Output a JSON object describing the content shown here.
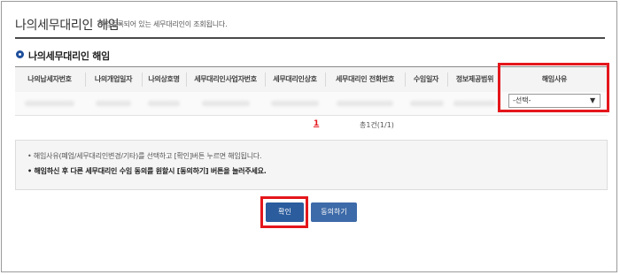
{
  "header": {
    "title": "나의세무대리인 해임",
    "description": "수임등록되어 있는 세무대리인이 조회됩니다."
  },
  "section": {
    "title": "나의세무대리인 해임"
  },
  "table": {
    "columns": [
      "나의납세자번호",
      "나의개업일자",
      "나의상호명",
      "세무대리인사업자번호",
      "세무대리인상호",
      "세무대리인 전화번호",
      "수임일자",
      "정보제공범위",
      "해임사유"
    ],
    "reason_select": {
      "selected": "-선택-"
    }
  },
  "pagination": {
    "current": "1",
    "total": "총1건(1/1)"
  },
  "notice": {
    "line1": "• 해임사유(폐업/세무대리인변경/기타)를 선택하고 [확인]버튼 누르면 해임됩니다.",
    "line2": "• 해임하신 후 다른 세무대리인 수임 동의를 원할시 [동의하기] 버튼을 눌러주세요."
  },
  "buttons": {
    "confirm": "확인",
    "agree": "동의하기"
  },
  "colors": {
    "highlight": "#e4161b",
    "primary_button": "#2a5c9e",
    "section_bullet": "#1e4f9c"
  }
}
